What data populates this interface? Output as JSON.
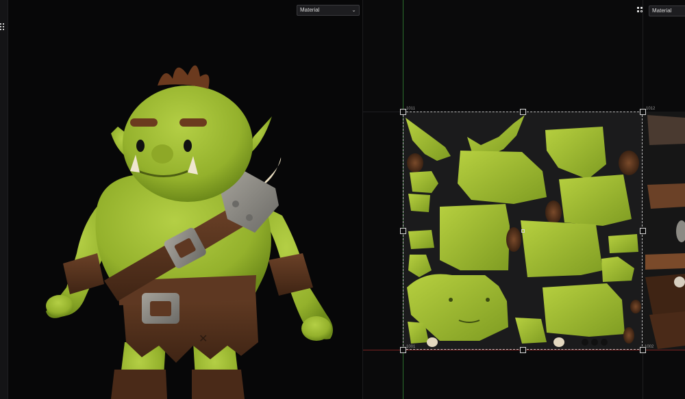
{
  "viewport": {
    "display_mode": "Material",
    "chevron": "⌄"
  },
  "uv_editor": {
    "display_mode": "Material",
    "menu_icon": "dots-grid-icon",
    "tile_labels": {
      "top_left": "1011",
      "top_right": "1012",
      "bottom_left": "1001",
      "bottom_right": "1002"
    }
  },
  "colors": {
    "skin": "#9cb834",
    "skin_dark": "#6f8a1c",
    "leather": "#5a3520",
    "metal": "#8c8a84",
    "hair": "#6b3a1e",
    "guide_green": "#2d6f2d",
    "guide_red": "#7a2222"
  }
}
